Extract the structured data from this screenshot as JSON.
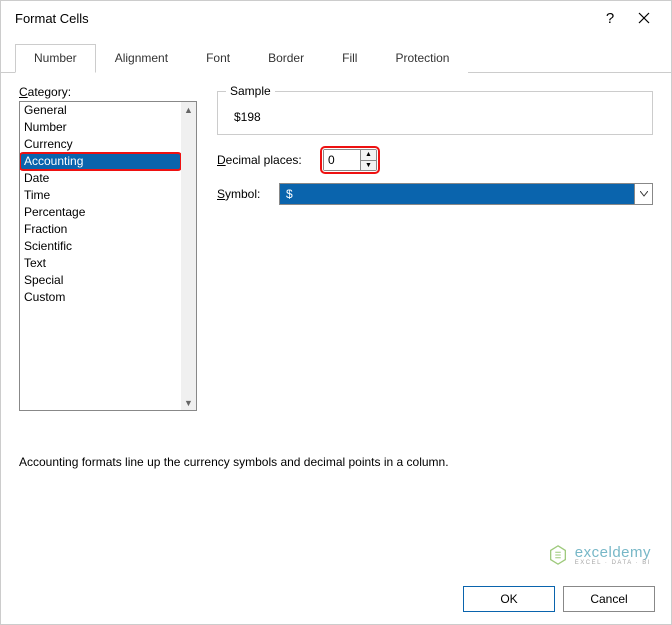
{
  "window": {
    "title": "Format Cells"
  },
  "tabs": {
    "items": [
      {
        "label": "Number"
      },
      {
        "label": "Alignment"
      },
      {
        "label": "Font"
      },
      {
        "label": "Border"
      },
      {
        "label": "Fill"
      },
      {
        "label": "Protection"
      }
    ],
    "active_index": 0
  },
  "category": {
    "label": "Category:",
    "items": [
      "General",
      "Number",
      "Currency",
      "Accounting",
      "Date",
      "Time",
      "Percentage",
      "Fraction",
      "Scientific",
      "Text",
      "Special",
      "Custom"
    ],
    "selected_index": 3
  },
  "sample": {
    "title": "Sample",
    "value": "$198"
  },
  "decimal": {
    "label": "Decimal places:",
    "value": "0"
  },
  "symbol": {
    "label": "Symbol:",
    "value": "$"
  },
  "description": "Accounting formats line up the currency symbols and decimal points in a column.",
  "footer": {
    "ok": "OK",
    "cancel": "Cancel"
  },
  "watermark": {
    "brand": "exceldemy",
    "sub": "EXCEL · DATA · BI"
  }
}
